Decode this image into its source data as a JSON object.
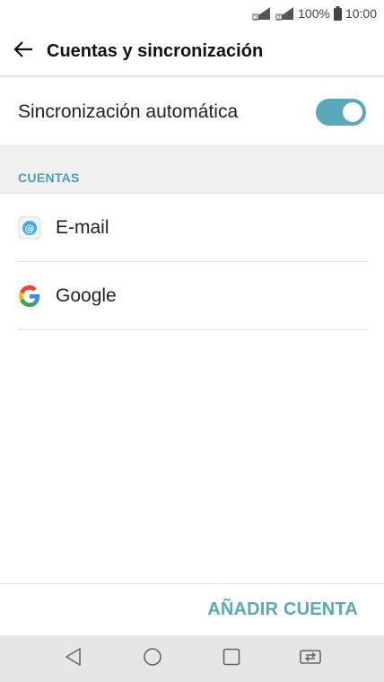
{
  "status_bar": {
    "battery": "100%",
    "time": "10:00",
    "icons": [
      "sim1-signal-icon",
      "sim2-signal-icon",
      "battery-icon"
    ]
  },
  "app_bar": {
    "title": "Cuentas y sincronización",
    "back_icon": "back-arrow-icon"
  },
  "sync": {
    "label": "Sincronización automática",
    "enabled": true,
    "accent_color": "#5aa9b8"
  },
  "accounts": {
    "section_label": "CUENTAS",
    "items": [
      {
        "label": "E-mail",
        "icon": "email-app-icon"
      },
      {
        "label": "Google",
        "icon": "google-icon"
      }
    ]
  },
  "actions": {
    "add_account_label": "AÑADIR CUENTA"
  },
  "nav_bar": {
    "buttons": [
      "back-nav-icon",
      "home-nav-icon",
      "recents-nav-icon",
      "dual-window-icon"
    ]
  }
}
